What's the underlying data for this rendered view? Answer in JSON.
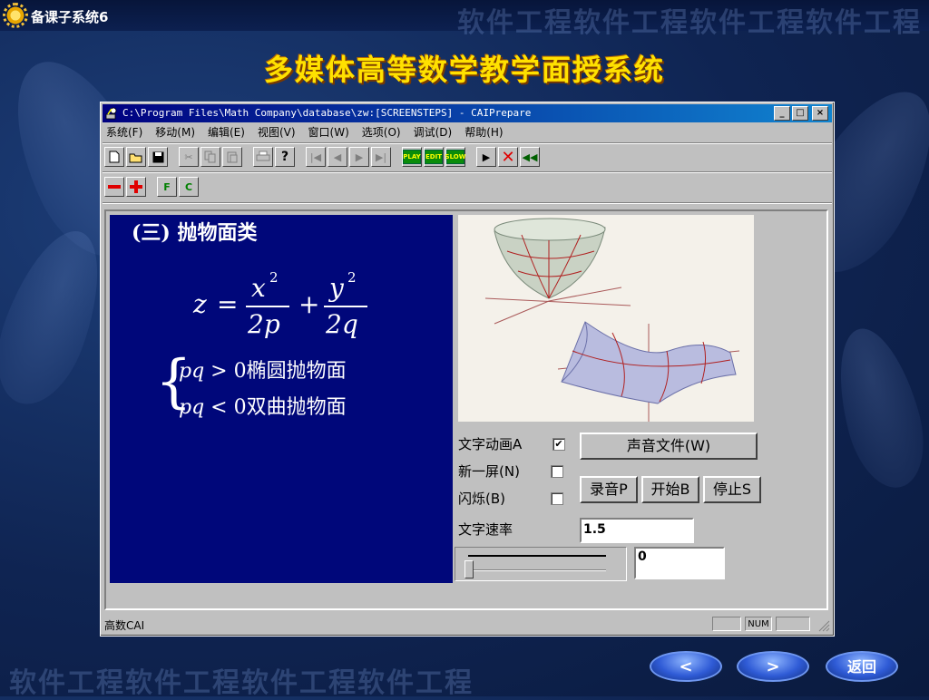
{
  "header": {
    "app_title": "备课子系统6",
    "watermark": "软件工程软件工程软件工程软件工程"
  },
  "slide": {
    "title": "多媒体高等数学教学面授系统"
  },
  "window": {
    "title": "C:\\Program Files\\Math Company\\database\\zw:[SCREENSTEPS] - CAIPrepare",
    "controls": {
      "minimize": "_",
      "maximize": "□",
      "close": "×"
    },
    "menu": [
      "系统(F)",
      "移动(M)",
      "编辑(E)",
      "视图(V)",
      "窗口(W)",
      "选项(O)",
      "调试(D)",
      "帮助(H)"
    ],
    "toolbar2": {
      "f_label": "F",
      "c_label": "C"
    },
    "content": {
      "heading": "(三) 抛物面类",
      "formula": {
        "z": "z",
        "eq": "=",
        "x": "x",
        "y": "y",
        "exp": "2",
        "plus": "+",
        "den1": "2p",
        "den2": "2q"
      },
      "cases": [
        {
          "lhs": "pq",
          "op": ">",
          "rhs": "0",
          "text": "椭圆抛物面"
        },
        {
          "lhs": "pq",
          "op": "<",
          "rhs": "0",
          "text": "双曲抛物面"
        }
      ]
    },
    "controls_panel": {
      "text_anim_label": "文字动画A",
      "text_anim_checked": true,
      "new_screen_label": "新一屏(N)",
      "new_screen_checked": false,
      "flash_label": "闪烁(B)",
      "flash_checked": false,
      "sound_file_button": "声音文件(W)",
      "record_button": "录音P",
      "start_button": "开始B",
      "stop_button": "停止S",
      "speed_label": "文字速率",
      "speed_value": "1.5",
      "slider_value": "0",
      "slider_level": 0.0
    },
    "status": {
      "text": "高数CAI",
      "num": "NUM"
    }
  },
  "nav": {
    "prev": "<",
    "next": ">",
    "back": "返回"
  },
  "colors": {
    "title_yellow": "#ffe100",
    "panel_blue": "#00077a",
    "window_gray": "#c0c0c0"
  }
}
